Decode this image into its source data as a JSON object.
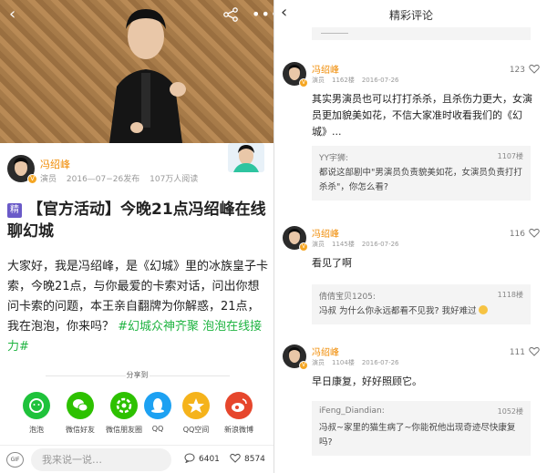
{
  "left": {
    "author": {
      "name": "冯绍峰",
      "role": "演员",
      "date": "2016—07−26发布",
      "reads": "107万人阅读"
    },
    "title": {
      "badge": "精",
      "text": "【官方活动】今晚21点冯绍峰在线聊幻城"
    },
    "body": {
      "text": "大家好，我是冯绍峰，是《幻城》里的冰族皇子卡索，今晚21点，与你最爱的卡索对话，问出你想问卡索的问题，本王亲自翻牌为你解惑，21点，我在泡泡，你来吗？",
      "tag": "#幻城众神齐聚 泡泡在线接力#"
    },
    "share": {
      "label": "分享到",
      "items": [
        {
          "label": "泡泡",
          "color": "#1fc23b",
          "icon": "paopao-icon"
        },
        {
          "label": "微信好友",
          "color": "#2dc100",
          "icon": "wechat-icon"
        },
        {
          "label": "微信朋友圈",
          "color": "#2dc100",
          "icon": "moments-icon"
        },
        {
          "label": "QQ",
          "color": "#1da1f2",
          "icon": "qq-icon"
        },
        {
          "label": "QQ空间",
          "color": "#f5b31b",
          "icon": "qzone-icon"
        },
        {
          "label": "新浪微博",
          "color": "#e6462c",
          "icon": "weibo-icon"
        }
      ]
    },
    "bottom": {
      "gif": "GIF",
      "placeholder": "我来说一说…",
      "comments": "6401",
      "likes": "8574"
    }
  },
  "right": {
    "title": "精彩评论",
    "comments": [
      {
        "name": "冯绍峰",
        "role": "演员",
        "floor": "1162楼",
        "date": "2016-07-26",
        "likes": "123",
        "text": "其实男演员也可以打打杀杀，且杀伤力更大，女演员更加貌美如花，不信大家准时收看我们的《幻城》...",
        "quote": {
          "user": "YY宇狮:",
          "floor": "1107楼",
          "text": "都说这部剧中\"男演员负责貌美如花，女演员负责打打杀杀\"，你怎么看?"
        }
      },
      {
        "name": "冯绍峰",
        "role": "演员",
        "floor": "1145楼",
        "date": "2016-07-26",
        "likes": "116",
        "text": "看见了啊",
        "quote": {
          "user": "倩倩宝贝1205:",
          "floor": "1118楼",
          "text": "冯叔   为什么你永远都看不见我? 我好难过"
        }
      },
      {
        "name": "冯绍峰",
        "role": "演员",
        "floor": "1104楼",
        "date": "2016-07-26",
        "likes": "111",
        "text": "早日康复，好好照顾它。",
        "quote": {
          "user": "iFeng_Diandian:",
          "floor": "1052楼",
          "text": "冯叔~家里的猫生病了~你能祝他出现奇迹尽快康复吗?"
        }
      }
    ]
  }
}
